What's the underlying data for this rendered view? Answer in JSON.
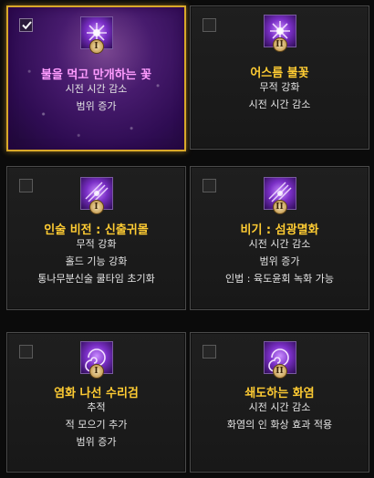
{
  "cards": [
    {
      "title": "불을 먹고 만개하는 꽃",
      "tier": "I",
      "selected": true,
      "icon": "flower-flame-icon",
      "effects": [
        "시전 시간 감소",
        "범위 증가"
      ]
    },
    {
      "title": "어스름 불꽃",
      "tier": "II",
      "selected": false,
      "icon": "flower-flame-icon",
      "effects": [
        "무적 강화",
        "시전 시간 감소"
      ]
    },
    {
      "title": "인술 비전 : 신출귀몰",
      "tier": "I",
      "selected": false,
      "icon": "talisman-icon",
      "effects": [
        "무적 강화",
        "홀드 기능 강화",
        "통나무분신술 쿨타임 초기화"
      ]
    },
    {
      "title": "비기 : 섬광멸화",
      "tier": "II",
      "selected": false,
      "icon": "talisman-icon",
      "effects": [
        "시전 시간 감소",
        "범위 증가",
        "인법 : 육도윤회 녹화 가능"
      ]
    },
    {
      "title": "염화 나선 수리검",
      "tier": "I",
      "selected": false,
      "icon": "spiral-shuriken-icon",
      "effects": [
        "추적",
        "적 모으기 추가",
        "범위 증가"
      ]
    },
    {
      "title": "쇄도하는 화염",
      "tier": "II",
      "selected": false,
      "icon": "spiral-shuriken-icon",
      "effects": [
        "시전 시간 감소",
        "화염의 인 화상 효과 적용"
      ]
    }
  ],
  "colors": {
    "selected_border": "#d9a82a",
    "title_gold": "#ffcc33",
    "title_selected": "#ff9cff",
    "effect_text": "#e4e4e4"
  }
}
